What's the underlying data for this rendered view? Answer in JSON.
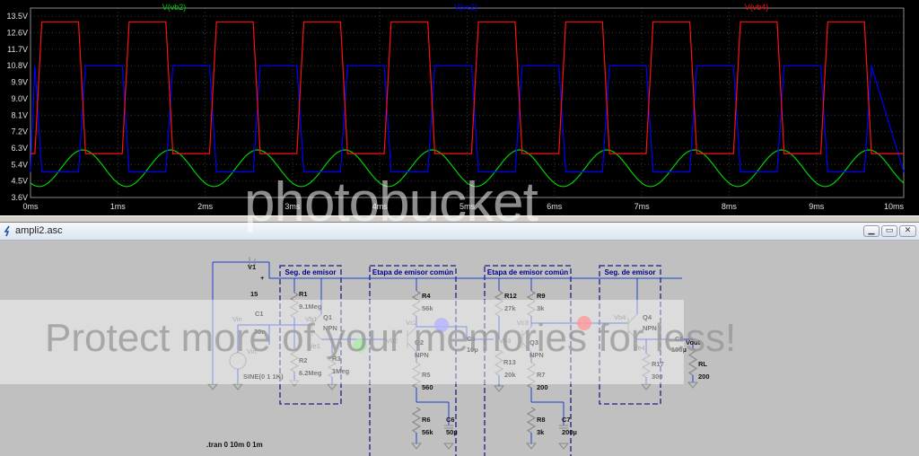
{
  "waveform": {
    "traces": [
      {
        "label": "V(vb2)",
        "color": "#00d000"
      },
      {
        "label": "V(vc2)",
        "color": "#0000ff"
      },
      {
        "label": "V(vb4)",
        "color": "#ff1010"
      }
    ],
    "y_ticks": [
      "13.5V",
      "12.6V",
      "11.7V",
      "10.8V",
      "9.9V",
      "9.0V",
      "8.1V",
      "7.2V",
      "6.3V",
      "5.4V",
      "4.5V",
      "3.6V"
    ],
    "x_ticks": [
      "0ms",
      "1ms",
      "2ms",
      "3ms",
      "4ms",
      "5ms",
      "6ms",
      "7ms",
      "8ms",
      "9ms",
      "10ms"
    ]
  },
  "chart_data": {
    "type": "line",
    "xlabel": "",
    "ylabel": "",
    "xlim": [
      0,
      10
    ],
    "ylim": [
      3.6,
      13.95
    ],
    "x_unit": "ms",
    "y_unit": "V",
    "grid": true,
    "legend_placement": "top",
    "series": [
      {
        "name": "V(vb2)",
        "shape": "sine",
        "offset_v": 5.2,
        "amplitude_v": 1.0,
        "period_ms": 1.0
      },
      {
        "name": "V(vc2)",
        "shape": "clipped square",
        "low_v": 5.0,
        "high_v": 10.8,
        "period_ms": 1.0
      },
      {
        "name": "V(vb4)",
        "shape": "clipped square",
        "low_v": 6.0,
        "high_v": 13.2,
        "period_ms": 1.0
      }
    ]
  },
  "schematic": {
    "window_title": "ampli2.asc",
    "blocks": [
      "Seg. de emisor",
      "Etapa de emisor común",
      "Etapa de emisor común",
      "Seg. de emisor"
    ],
    "labels": [
      {
        "t": "V1",
        "bold": true
      },
      {
        "t": "15",
        "bold": true
      },
      {
        "t": "+",
        "bold": true
      },
      {
        "t": "Vin"
      },
      {
        "t": "C1",
        "bold": true
      },
      {
        "t": "30n",
        "bold": true
      },
      {
        "t": "Vin"
      },
      {
        "t": "SINE(0 1 1K)",
        "bold": true
      },
      {
        "t": "R1",
        "bold": true
      },
      {
        "t": "9.1Meg",
        "bold": true
      },
      {
        "t": "Q1",
        "bold": true
      },
      {
        "t": "NPN",
        "bold": true
      },
      {
        "t": "Vb1"
      },
      {
        "t": "Ve1"
      },
      {
        "t": "R2",
        "bold": true
      },
      {
        "t": "6.2Meg",
        "bold": true
      },
      {
        "t": "R3",
        "bold": true
      },
      {
        "t": "1Meg",
        "bold": true
      },
      {
        "t": "R4",
        "bold": true
      },
      {
        "t": "56k",
        "bold": true
      },
      {
        "t": "Vc2"
      },
      {
        "t": "Vb2"
      },
      {
        "t": "Q2",
        "bold": true
      },
      {
        "t": "NPN",
        "bold": true
      },
      {
        "t": "R5",
        "bold": true
      },
      {
        "t": "560",
        "bold": true
      },
      {
        "t": "R6",
        "bold": true
      },
      {
        "t": "56k",
        "bold": true
      },
      {
        "t": "C6",
        "bold": true
      },
      {
        "t": "50µ",
        "bold": true
      },
      {
        "t": "C3",
        "bold": true
      },
      {
        "t": "10µ",
        "bold": true
      },
      {
        "t": "R12",
        "bold": true
      },
      {
        "t": "27k",
        "bold": true
      },
      {
        "t": "R9",
        "bold": true
      },
      {
        "t": "3k",
        "bold": true
      },
      {
        "t": "Vc3"
      },
      {
        "t": "Vb3"
      },
      {
        "t": "Q3",
        "bold": true
      },
      {
        "t": "NPN",
        "bold": true
      },
      {
        "t": "R13",
        "bold": true
      },
      {
        "t": "20k",
        "bold": true
      },
      {
        "t": "R7",
        "bold": true
      },
      {
        "t": "200",
        "bold": true
      },
      {
        "t": "R8",
        "bold": true
      },
      {
        "t": "3k",
        "bold": true
      },
      {
        "t": "C7",
        "bold": true
      },
      {
        "t": "200µ",
        "bold": true
      },
      {
        "t": "Vb4"
      },
      {
        "t": "Q4",
        "bold": true
      },
      {
        "t": "NPN",
        "bold": true
      },
      {
        "t": "Ve4"
      },
      {
        "t": "C5",
        "bold": true
      },
      {
        "t": "100µ",
        "bold": true
      },
      {
        "t": "R17",
        "bold": true
      },
      {
        "t": "300",
        "bold": true
      },
      {
        "t": "Vout",
        "bold": true
      },
      {
        "t": "RL",
        "bold": true
      },
      {
        "t": "200",
        "bold": true
      }
    ],
    "directive": ".tran 0 10m 0 1m"
  },
  "watermarks": {
    "logo": "photobucket",
    "banner": "Protect more of your memories for less!"
  }
}
